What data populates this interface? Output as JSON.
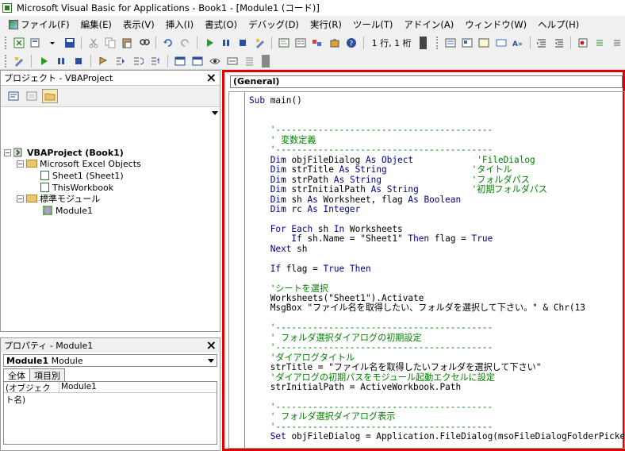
{
  "window": {
    "title": "Microsoft Visual Basic for Applications - Book1 - [Module1 (コード)]"
  },
  "menu": [
    {
      "label": "ファイル(F)",
      "icon": "vba-icon"
    },
    {
      "label": "編集(E)"
    },
    {
      "label": "表示(V)"
    },
    {
      "label": "挿入(I)"
    },
    {
      "label": "書式(O)"
    },
    {
      "label": "デバッグ(D)"
    },
    {
      "label": "実行(R)"
    },
    {
      "label": "ツール(T)"
    },
    {
      "label": "アドイン(A)"
    },
    {
      "label": "ウィンドウ(W)"
    },
    {
      "label": "ヘルプ(H)"
    }
  ],
  "toolbar": {
    "position": "1 行, 1 桁"
  },
  "project": {
    "title": "プロジェクト - VBAProject",
    "close": "×",
    "tree": {
      "root": "VBAProject (Book1)",
      "excel_objects": "Microsoft Excel Objects",
      "sheet1": "Sheet1 (Sheet1)",
      "thisworkbook": "ThisWorkbook",
      "modules": "標準モジュール",
      "module1": "Module1"
    }
  },
  "properties": {
    "title": "プロパティ - Module1",
    "close": "×",
    "object_name": "Module1",
    "object_type": "Module",
    "tab_all": "全体",
    "tab_category": "項目別",
    "row_key": "(オブジェクト名)",
    "row_value": "Module1"
  },
  "code": {
    "object_combo": "(General)",
    "lines": [
      [
        [
          "kw",
          "Sub"
        ],
        [
          "t",
          " main()"
        ]
      ],
      [],
      [],
      [
        [
          "cm",
          "    '-----------------------------------------"
        ]
      ],
      [
        [
          "cm",
          "    ' 変数定義"
        ]
      ],
      [
        [
          "cm",
          "    '-----------------------------------------"
        ]
      ],
      [
        [
          "kw",
          "    Dim"
        ],
        [
          "t",
          " objFileDialog "
        ],
        [
          "kw",
          "As"
        ],
        [
          "t",
          " "
        ],
        [
          "kw",
          "Object"
        ],
        [
          "t",
          "            "
        ],
        [
          "cm",
          "'FileDialog"
        ]
      ],
      [
        [
          "kw",
          "    Dim"
        ],
        [
          "t",
          " strTitle "
        ],
        [
          "kw",
          "As"
        ],
        [
          "t",
          " "
        ],
        [
          "kw",
          "String"
        ],
        [
          "t",
          "                "
        ],
        [
          "cm",
          "'タイトル"
        ]
      ],
      [
        [
          "kw",
          "    Dim"
        ],
        [
          "t",
          " strPath "
        ],
        [
          "kw",
          "As"
        ],
        [
          "t",
          " "
        ],
        [
          "kw",
          "String"
        ],
        [
          "t",
          "                 "
        ],
        [
          "cm",
          "'フォルダパス"
        ]
      ],
      [
        [
          "kw",
          "    Dim"
        ],
        [
          "t",
          " strInitialPath "
        ],
        [
          "kw",
          "As"
        ],
        [
          "t",
          " "
        ],
        [
          "kw",
          "String"
        ],
        [
          "t",
          "          "
        ],
        [
          "cm",
          "'初期フォルダパス"
        ]
      ],
      [
        [
          "kw",
          "    Dim"
        ],
        [
          "t",
          " sh "
        ],
        [
          "kw",
          "As"
        ],
        [
          "t",
          " Worksheet, flag "
        ],
        [
          "kw",
          "As"
        ],
        [
          "t",
          " "
        ],
        [
          "kw",
          "Boolean"
        ]
      ],
      [
        [
          "kw",
          "    Dim"
        ],
        [
          "t",
          " rc "
        ],
        [
          "kw",
          "As"
        ],
        [
          "t",
          " "
        ],
        [
          "kw",
          "Integer"
        ]
      ],
      [],
      [
        [
          "kw",
          "    For Each"
        ],
        [
          "t",
          " sh "
        ],
        [
          "kw",
          "In"
        ],
        [
          "t",
          " Worksheets"
        ]
      ],
      [
        [
          "kw",
          "        If"
        ],
        [
          "t",
          " sh.Name = \"Sheet1\" "
        ],
        [
          "kw",
          "Then"
        ],
        [
          "t",
          " flag = "
        ],
        [
          "kw",
          "True"
        ]
      ],
      [
        [
          "kw",
          "    Next"
        ],
        [
          "t",
          " sh"
        ]
      ],
      [],
      [
        [
          "kw",
          "    If"
        ],
        [
          "t",
          " flag = "
        ],
        [
          "kw",
          "True Then"
        ]
      ],
      [],
      [
        [
          "cm",
          "    'シートを選択"
        ]
      ],
      [
        [
          "t",
          "    Worksheets(\"Sheet1\").Activate"
        ]
      ],
      [
        [
          "t",
          "    MsgBox \"ファイル名を取得したい、フォルダを選択して下さい。\" & Chr(13"
        ]
      ],
      [],
      [
        [
          "cm",
          "    '-----------------------------------------"
        ]
      ],
      [
        [
          "cm",
          "    ' フォルダ選択ダイアログの初期設定"
        ]
      ],
      [
        [
          "cm",
          "    '-----------------------------------------"
        ]
      ],
      [
        [
          "cm",
          "    'ダイアログタイトル"
        ]
      ],
      [
        [
          "t",
          "    strTitle = \"ファイル名を取得したいフォルダを選択して下さい\""
        ]
      ],
      [
        [
          "cm",
          "    'ダイアログの初期パスをモジュール起動エクセルに設定"
        ]
      ],
      [
        [
          "t",
          "    strInitialPath = ActiveWorkbook.Path"
        ]
      ],
      [],
      [
        [
          "cm",
          "    '-----------------------------------------"
        ]
      ],
      [
        [
          "cm",
          "    ' フォルダ選択ダイアログ表示"
        ]
      ],
      [
        [
          "cm",
          "    '-----------------------------------------"
        ]
      ],
      [
        [
          "kw",
          "    Set"
        ],
        [
          "t",
          " objFileDialog = Application.FileDialog(msoFileDialogFolderPicker"
        ]
      ]
    ]
  },
  "colors": {
    "keyword": "#00008b",
    "comment": "#008000",
    "highlight_border": "#e00000"
  }
}
